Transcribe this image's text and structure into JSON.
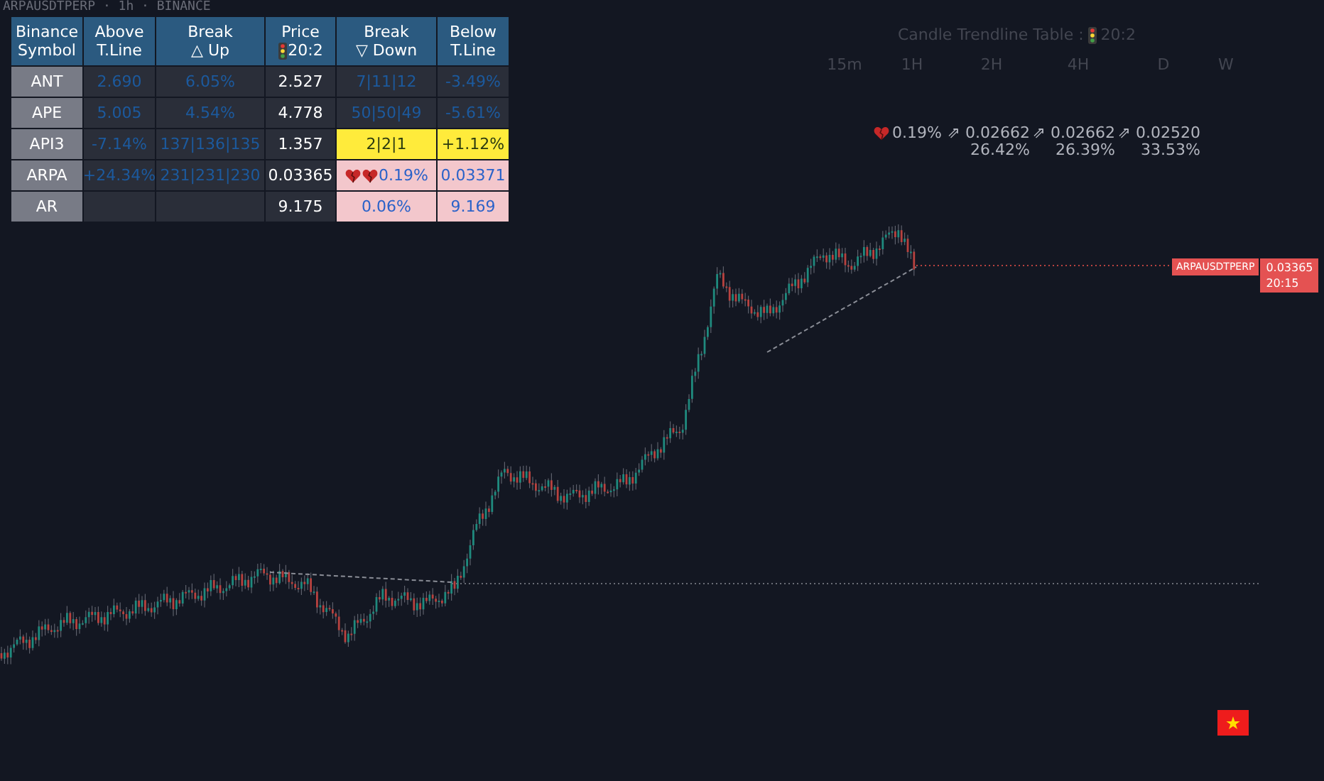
{
  "chart_title": "ARPAUSDTPERP · 1h · BINANCE",
  "table": {
    "columns": [
      {
        "lines": [
          "Binance",
          "Symbol"
        ]
      },
      {
        "lines": [
          "Above",
          "T.Line"
        ]
      },
      {
        "lines": [
          "Break",
          "△ Up"
        ]
      },
      {
        "lines": [
          "Price",
          "20:2"
        ],
        "kind": "clock"
      },
      {
        "lines": [
          "Break",
          "▽ Down"
        ]
      },
      {
        "lines": [
          "Below",
          "T.Line"
        ]
      }
    ],
    "rows": [
      {
        "cells": [
          {
            "text": "ANT",
            "warning": false,
            "alert": false
          },
          {
            "text": "2.690",
            "warning": false,
            "alert": false
          },
          {
            "text": "6.05%",
            "warning": false,
            "alert": false
          },
          {
            "text": "2.527",
            "warning": false,
            "alert": false
          },
          {
            "text": "7|11|12",
            "warning": false,
            "alert": false
          },
          {
            "text": "-3.49%",
            "warning": false,
            "alert": false
          }
        ]
      },
      {
        "cells": [
          {
            "text": "APE",
            "warning": false,
            "alert": false
          },
          {
            "text": "5.005",
            "warning": false,
            "alert": false
          },
          {
            "text": "4.54%",
            "warning": false,
            "alert": false
          },
          {
            "text": "4.778",
            "warning": false,
            "alert": false
          },
          {
            "text": "50|50|49",
            "warning": false,
            "alert": false
          },
          {
            "text": "-5.61%",
            "warning": false,
            "alert": false
          }
        ]
      },
      {
        "cells": [
          {
            "text": "API3",
            "warning": false,
            "alert": false
          },
          {
            "text": "-7.14%",
            "warning": false,
            "alert": false
          },
          {
            "text": "137|136|135",
            "warning": false,
            "alert": false
          },
          {
            "text": "1.357",
            "warning": false,
            "alert": false
          },
          {
            "text": "2|2|1",
            "warning": true,
            "alert": false
          },
          {
            "text": "+1.12%",
            "warning": true,
            "alert": false
          }
        ]
      },
      {
        "cells": [
          {
            "text": "ARPA",
            "warning": false,
            "alert": false
          },
          {
            "text": "+24.34%",
            "warning": false,
            "alert": false
          },
          {
            "text": "231|231|230",
            "warning": false,
            "alert": false
          },
          {
            "text": "0.03365",
            "warning": false,
            "alert": false
          },
          {
            "text": "0.19%",
            "warning": false,
            "alert": true,
            "kind": "heartbreak"
          },
          {
            "text": "0.03371",
            "warning": false,
            "alert": true
          }
        ]
      },
      {
        "cells": [
          {
            "text": "AR",
            "warning": false,
            "alert": false
          },
          {
            "warning": false,
            "alert": false
          },
          {
            "warning": false,
            "alert": false
          },
          {
            "text": "9.175",
            "warning": false,
            "alert": false
          },
          {
            "text": "0.06%",
            "warning": false,
            "alert": true
          },
          {
            "text": "9.169",
            "warning": false,
            "alert": true
          }
        ]
      }
    ]
  },
  "trend_table": {
    "title": "Candle Trendline Table :",
    "time": "20:2",
    "timeframes": [
      {
        "label": "15m"
      },
      {
        "label": "1H",
        "kind": "heartbreak",
        "value": "0.19%"
      },
      {
        "label": "2H",
        "kind": "arrow",
        "arrow": "⇗",
        "value": "0.02662",
        "change": "26.42%"
      },
      {
        "label": "4H",
        "kind": "arrow",
        "arrow": "⇗",
        "value": "0.02662",
        "change": "26.39%"
      },
      {
        "label": "D",
        "kind": "arrow",
        "arrow": "⇗",
        "value": "0.02520",
        "change": "33.53%"
      },
      {
        "label": "W"
      }
    ]
  },
  "price_label": {
    "symbol": "ARPAUSDTPERP",
    "price": "0.03365",
    "countdown": "20:15"
  }
}
